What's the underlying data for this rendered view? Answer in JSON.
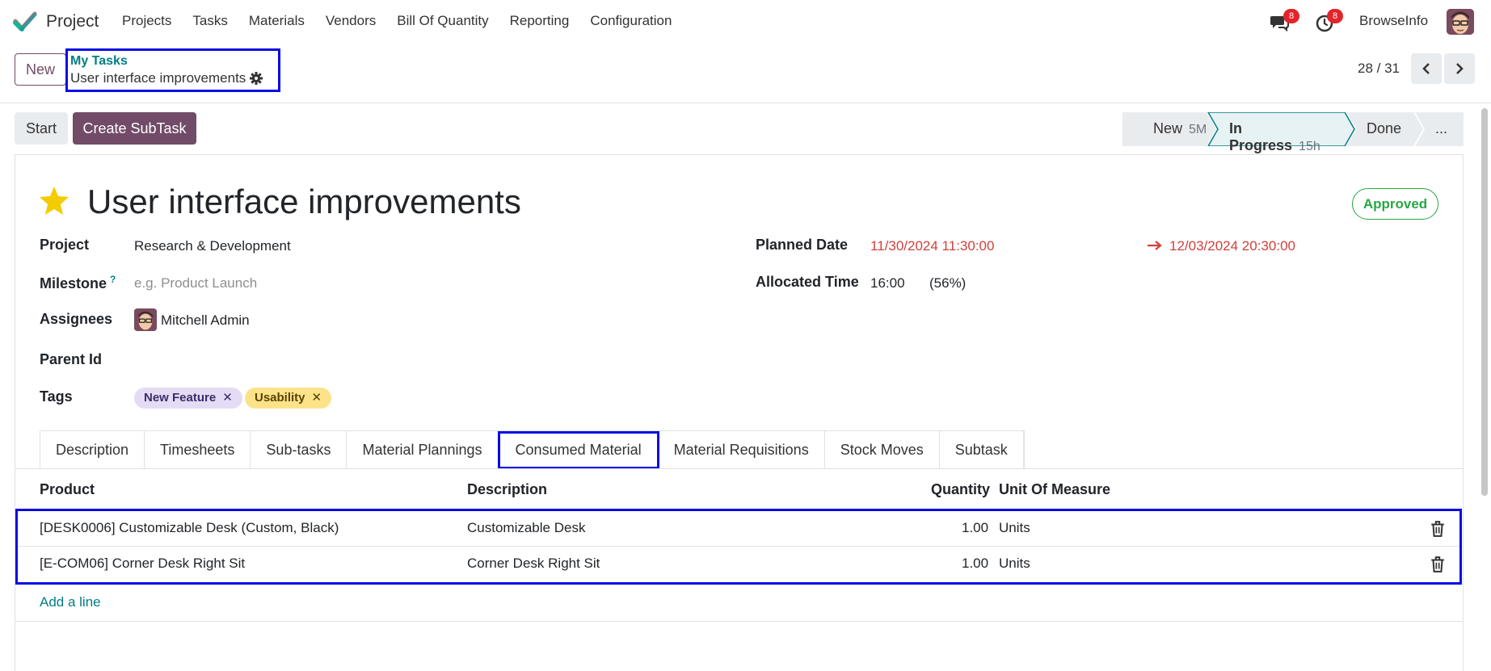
{
  "topnav": {
    "app_name": "Project",
    "menu": [
      "Projects",
      "Tasks",
      "Materials",
      "Vendors",
      "Bill Of Quantity",
      "Reporting",
      "Configuration"
    ],
    "messages_count": "8",
    "activities_count": "8",
    "company": "BrowseInfo"
  },
  "control_panel": {
    "new_label": "New",
    "breadcrumb_parent": "My Tasks",
    "breadcrumb_current": "User interface improvements",
    "pager": "28 / 31"
  },
  "statusbar": {
    "start_label": "Start",
    "create_subtask_label": "Create SubTask",
    "stages": [
      {
        "label": "New",
        "time": "5M"
      },
      {
        "label": "In Progress",
        "time": "15h"
      },
      {
        "label": "Done",
        "time": ""
      },
      {
        "label": "...",
        "time": ""
      }
    ]
  },
  "form": {
    "title": "User interface improvements",
    "state_badge": "Approved",
    "fields": {
      "project_label": "Project",
      "project_value": "Research & Development",
      "milestone_label": "Milestone",
      "milestone_help": "?",
      "milestone_placeholder": "e.g. Product Launch",
      "assignees_label": "Assignees",
      "assignee_name": "Mitchell Admin",
      "parent_label": "Parent Id",
      "tags_label": "Tags",
      "tags": [
        "New Feature",
        "Usability"
      ],
      "planned_date_label": "Planned Date",
      "planned_start": "11/30/2024 11:30:00",
      "planned_end": "12/03/2024 20:30:00",
      "allocated_label": "Allocated Time",
      "allocated_value": "16:00",
      "allocated_pct": "(56%)"
    },
    "tabs": [
      "Description",
      "Timesheets",
      "Sub-tasks",
      "Material Plannings",
      "Consumed Material",
      "Material Requisitions",
      "Stock Moves",
      "Subtask"
    ],
    "active_tab": "Consumed Material",
    "table": {
      "headers": [
        "Product",
        "Description",
        "Quantity",
        "Unit Of Measure"
      ],
      "rows": [
        {
          "product": "[DESK0006] Customizable Desk (Custom, Black)",
          "description": "Customizable Desk",
          "quantity": "1.00",
          "uom": "Units"
        },
        {
          "product": "[E-COM06] Corner Desk Right Sit",
          "description": "Corner Desk Right Sit",
          "quantity": "1.00",
          "uom": "Units"
        }
      ],
      "add_line": "Add a line"
    }
  },
  "colors": {
    "brand": "#714b67",
    "link": "#017e84",
    "highlight": "#0a0ae6",
    "danger": "#d23f3a",
    "success": "#28a745"
  }
}
